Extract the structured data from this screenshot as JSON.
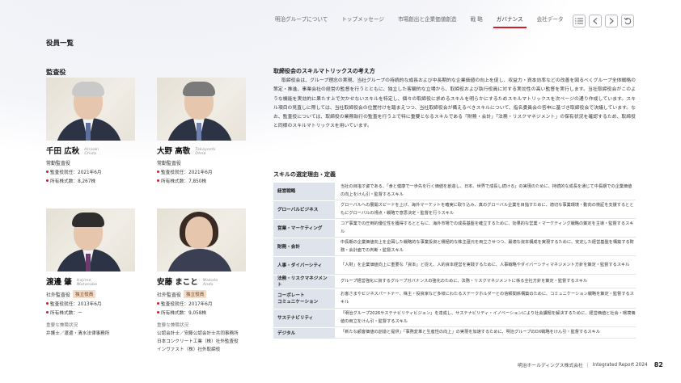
{
  "nav": {
    "items": [
      "明治グループについて",
      "トップメッセージ",
      "市場創出と企業価値創造",
      "戦 略",
      "ガバナンス",
      "会社データ"
    ],
    "active_index": 4,
    "icons": [
      "list-icon",
      "prev-page-icon",
      "next-page-icon",
      "back-icon"
    ]
  },
  "page_title": "役員一覧",
  "section_heading": "監査役",
  "officers": [
    {
      "name_jp": "千田 広秋",
      "name_en_first": "Hiroaki",
      "name_en_last": "Chida",
      "role": "常勤監査役",
      "badge": "",
      "appointed": "監査役就任：2021年6月",
      "shares": "所有株式数：8,267株",
      "concurrent_label": "",
      "concurrent": []
    },
    {
      "name_jp": "大野 高敬",
      "name_en_first": "Takayoshi",
      "name_en_last": "Ohno",
      "role": "常勤監査役",
      "badge": "",
      "appointed": "監査役就任：2021年6月",
      "shares": "所有株式数：7,850株",
      "concurrent_label": "",
      "concurrent": []
    },
    {
      "name_jp": "渡邊 肇",
      "name_en_first": "Hajime",
      "name_en_last": "Watanabe",
      "role": "社外監査役",
      "badge": "独立役員",
      "appointed": "監査役就任：2013年6月",
      "shares": "所有株式数：ー",
      "concurrent_label": "重要な兼職状況",
      "concurrent": [
        "弁護士／渡邊・清水法律事務所"
      ]
    },
    {
      "name_jp": "安藤 まこと",
      "name_en_first": "Makoto",
      "name_en_last": "Ando",
      "role": "社外監査役",
      "badge": "独立役員",
      "appointed": "監査役就任：2017年6月",
      "shares": "所有株式数：9,058株",
      "concurrent_label": "重要な兼職状況",
      "concurrent": [
        "公認会計士／安藤公認会計士共同事務所",
        "日本コンクリート工業（株）社外監査役",
        "インヴァスト（株）社外取締役"
      ]
    }
  ],
  "matrix": {
    "title": "取締役会のスキルマトリックスの考え方",
    "body": "取締役会は、グループ理念の実現、当社グループの持続的な成長および中長期的な企業価値の向上を促し、収益力・資本効率などの改善を図るべくグループ全体戦略の策定・推進、事業会社の経営の監督を行うとともに、独立した客観的な立場から、取締役および執行役員に対する実効性の高い監督を実行します。当社取締役会がこのような機能を実効的に果たす上で欠かせないスキルを特定し、個々の取締役に求めるスキルを明らかにするためスキルマトリックスを次ページの通り作成しています。スキル項目の見直しに際しては、当社取締役会の位置付けを踏まえつつ、当社取締役会が備えるべきスキルについて、指名委員会の答申に基づき取締役会で決議しています。なお、監査役については、取締役の業務執行の監査を行う上で特に重要となるスキルである「財務・会計」「法務・リスクマネジメント」の保有状況を確認するため、取締役と同様のスキルマトリックスを用いています。"
  },
  "skills": {
    "title": "スキルの選定理由・定義",
    "rows": [
      {
        "name": "経営戦略",
        "desc": "当社の目指す姿である、「食と健康で一歩先を行く価値を創造し、日本、世界で成長し続ける」の実現のために、持続的な成長を通じて中長期での企業価値の向上をけん引・監督するスキル"
      },
      {
        "name": "グローバルビジネス",
        "desc": "グローバルへの展開スピードを上げ、海外マーケットを確実に取り込み、真のグローバル企業を目指すために、適切な事業環境・動向の検証を支援するとともにグローバルの視点・戦略で意思決定・監督を行うスキル"
      },
      {
        "name": "営業・マーケティング",
        "desc": "コア事業での圧倒的優位性を獲得するとともに、海外市場での成長基盤を確立するために、効果的な営業・マーケティング戦略の策定を主導・監督するスキル"
      },
      {
        "name": "財務・会計",
        "desc": "中長期の企業価値向上を企図した戦略的な事業投資と積極的な株主還元を両立させつつ、最適な資本構成を実現するために、安定した経営基盤を構築する財務・会計面での判断・監督スキル"
      },
      {
        "name": "人事・ダイバーシティ",
        "desc": "「人財」を企業価値向上に重要な「資本」と捉え、人的資本経営を実践するために、人事戦略やダイバーシティマネジメント方針を策定・監督するスキル"
      },
      {
        "name": "法務・リスクマネジメント",
        "desc": "グループ経営強化に資するグループガバナンスの強化のために、法務・リスクマネジメントに係る全社方針を策定・監督するスキル"
      },
      {
        "name": "コーポレート\nコミュニケーション",
        "desc": "お客さまやビジネスパートナー、株主・投資家など多岐にわたるステークホルダーとの信頼関係構築のために、コミュニケーション戦略を策定・監督するスキル"
      },
      {
        "name": "サステナビリティ",
        "desc": "「明治グループ2026サステナビリティビジョン」を達成し、サステナビリティ・イノベーションにより社会課題を解決するために、経営価値と社会・環境価値の両立をけん引・監督するスキル"
      },
      {
        "name": "デジタル",
        "desc": "「新たな顧客価値の創造と提供」「事務変革と生産性の向上」の実現を加速するために、明治グループのDX戦略をけん引・監督するスキル"
      }
    ]
  },
  "footer": {
    "company": "明治ホールディングス株式会社",
    "report": "Integrated Report 2024",
    "page": "82"
  }
}
